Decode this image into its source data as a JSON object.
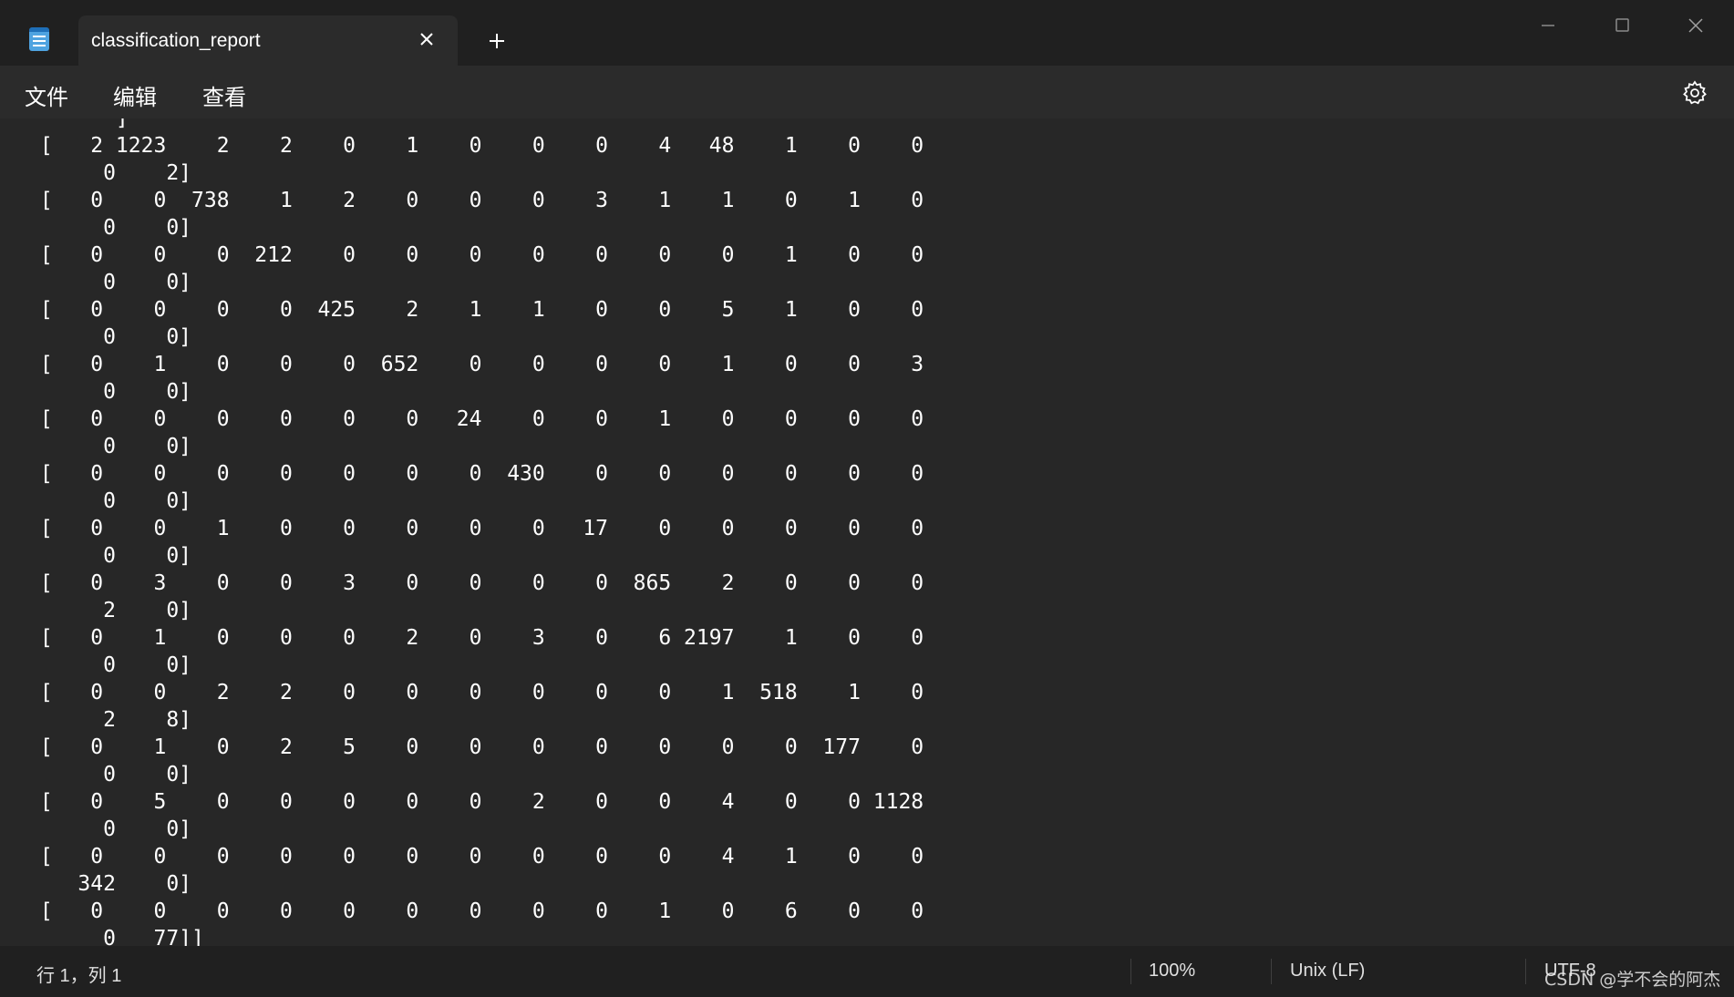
{
  "tab": {
    "title": "classification_report"
  },
  "menu": {
    "items": [
      "文件",
      "编辑",
      "查看"
    ]
  },
  "editor": {
    "lines": [
      "       ]",
      " [   2 1223    2    2    0    1    0    0    0    4   48    1    0    0",
      "      0    2]",
      " [   0    0  738    1    2    0    0    0    3    1    1    0    1    0",
      "      0    0]",
      " [   0    0    0  212    0    0    0    0    0    0    0    1    0    0",
      "      0    0]",
      " [   0    0    0    0  425    2    1    1    0    0    5    1    0    0",
      "      0    0]",
      " [   0    1    0    0    0  652    0    0    0    0    1    0    0    3",
      "      0    0]",
      " [   0    0    0    0    0    0   24    0    0    1    0    0    0    0",
      "      0    0]",
      " [   0    0    0    0    0    0    0  430    0    0    0    0    0    0",
      "      0    0]",
      " [   0    0    1    0    0    0    0    0   17    0    0    0    0    0",
      "      0    0]",
      " [   0    3    0    0    3    0    0    0    0  865    2    0    0    0",
      "      2    0]",
      " [   0    1    0    0    0    2    0    3    0    6 2197    1    0    0",
      "      0    0]",
      " [   0    0    2    2    0    0    0    0    0    0    1  518    1    0",
      "      2    8]",
      " [   0    1    0    2    5    0    0    0    0    0    0    0  177    0",
      "      0    0]",
      " [   0    5    0    0    0    0    0    2    0    0    4    0    0 1128",
      "      0    0]",
      " [   0    0    0    0    0    0    0    0    0    0    4    1    0    0",
      "    342    0]",
      " [   0    0    0    0    0    0    0    0    0    1    0    6    0    0",
      "      0   77]]"
    ]
  },
  "status": {
    "position": "行 1，列 1",
    "zoom": "100%",
    "line_ending": "Unix (LF)",
    "encoding": "UTF-8"
  },
  "watermark": "CSDN @学不会的阿杰",
  "icons": {
    "app": "notepad-icon",
    "tab_close": "close-icon",
    "new_tab": "plus-icon",
    "minimize": "minimize-icon",
    "maximize": "maximize-icon",
    "close": "close-icon",
    "settings": "gear-icon"
  },
  "colors": {
    "background": "#272727",
    "titlebar": "#202020",
    "tab": "#2b2b2b",
    "text": "#ffffff"
  }
}
